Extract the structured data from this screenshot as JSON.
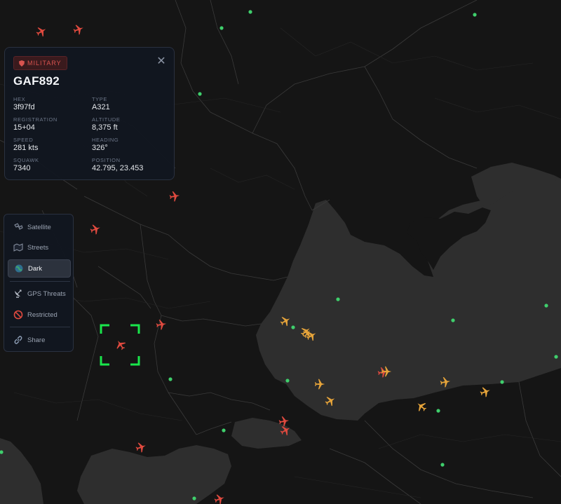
{
  "aircraft": {
    "badge": "MILITARY",
    "callsign": "GAF892",
    "fields": [
      {
        "label": "HEX",
        "value": "3f97fd"
      },
      {
        "label": "TYPE",
        "value": "A321"
      },
      {
        "label": "REGISTRATION",
        "value": "15+04"
      },
      {
        "label": "ALTITUDE",
        "value": "8,375 ft"
      },
      {
        "label": "SPEED",
        "value": "281 kts"
      },
      {
        "label": "HEADING",
        "value": "326°"
      },
      {
        "label": "SQUAWK",
        "value": "7340"
      },
      {
        "label": "POSITION",
        "value": "42.795, 23.453"
      }
    ],
    "close_icon": "close-icon"
  },
  "layers": {
    "items": [
      {
        "label": "Satellite",
        "icon": "satellite-icon",
        "active": false
      },
      {
        "label": "Streets",
        "icon": "streets-icon",
        "active": false
      },
      {
        "label": "Dark",
        "icon": "globe-icon",
        "active": true
      },
      {
        "label": "GPS Threats",
        "icon": "radar-dish-icon",
        "active": false
      },
      {
        "label": "Restricted",
        "icon": "no-entry-icon",
        "active": false
      },
      {
        "label": "Share",
        "icon": "link-icon",
        "active": false
      }
    ]
  },
  "colors": {
    "military": "#e04a3f",
    "civil": "#e6a43a",
    "ground": "#3fcf6c",
    "selection": "#19e64b",
    "land": "#151515",
    "sea": "#2f2f2f"
  }
}
